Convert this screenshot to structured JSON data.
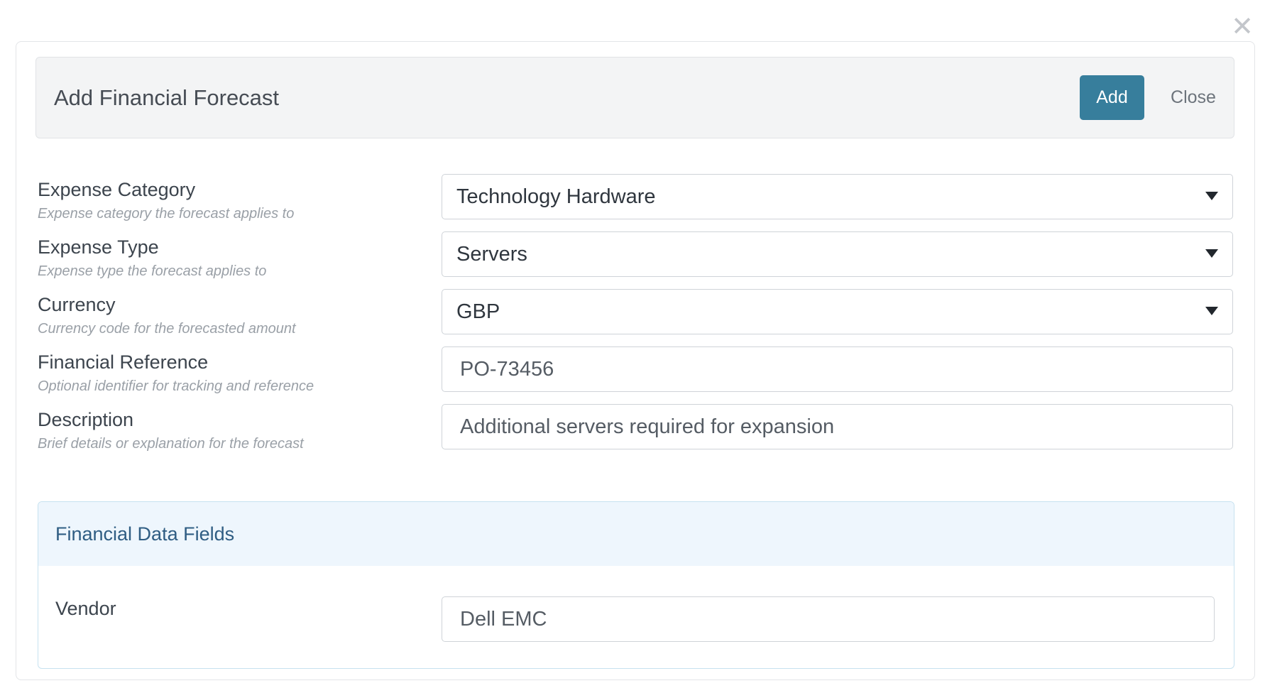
{
  "modal": {
    "title": "Add Financial Forecast",
    "add_label": "Add",
    "close_label": "Close"
  },
  "fields": [
    {
      "label": "Expense Category",
      "hint": "Expense category the forecast applies to",
      "type": "select",
      "value": "Technology Hardware"
    },
    {
      "label": "Expense Type",
      "hint": "Expense type the forecast applies to",
      "type": "select",
      "value": "Servers"
    },
    {
      "label": "Currency",
      "hint": "Currency code for the forecasted amount",
      "type": "select",
      "value": "GBP"
    },
    {
      "label": "Financial Reference",
      "hint": "Optional identifier for tracking and reference",
      "type": "text",
      "value": "PO-73456"
    },
    {
      "label": "Description",
      "hint": "Brief details or explanation for the forecast",
      "type": "text",
      "value": "Additional servers required for expansion"
    }
  ],
  "financial_section": {
    "title": "Financial Data Fields",
    "vendor_label": "Vendor",
    "vendor_value": "Dell EMC"
  },
  "colors": {
    "primary_button": "#377e9c",
    "section_header_bg": "#eef6fd",
    "section_title": "#2f5d83"
  },
  "icons": {
    "dismiss": "close-icon",
    "select_caret": "chevron-down-icon"
  }
}
